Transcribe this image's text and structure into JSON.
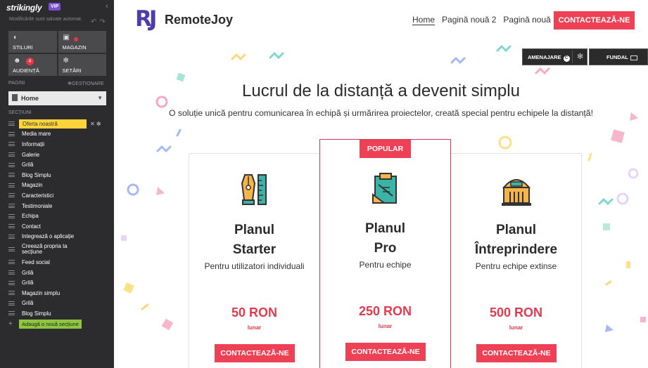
{
  "editor": {
    "logo": "strikingly",
    "vip": "VIP",
    "autosave": "Modificările sunt salvate automat.",
    "tiles": [
      {
        "label": "STILURI",
        "icon": "palette-icon"
      },
      {
        "label": "MAGAZIN",
        "icon": "bag-icon"
      },
      {
        "label": "AUDIENȚĂ",
        "icon": "people-icon",
        "count": "4"
      },
      {
        "label": "SETĂRI",
        "icon": "gear-icon"
      }
    ],
    "pages_label": "PAGINI",
    "manage_label": "GESTIONARE",
    "current_page": "Home",
    "sections_label": "SECȚIUNI",
    "sections": [
      "Oferta noastră",
      "Media mare",
      "Informații",
      "Galerie",
      "Grilă",
      "Blog Simplu",
      "Magazin",
      "Caracteristici",
      "Testimoniale",
      "Echipa",
      "Contact",
      "Integrează o aplicație",
      "Creează propria ta secțiune",
      "Feed social",
      "Grilă",
      "Grilă",
      "Magazin simplu",
      "Grilă",
      "Blog Simplu"
    ],
    "add_section": "Adaugă o nouă secțiune"
  },
  "site": {
    "brand_mark": "RJ",
    "brand_name": "RemoteJoy",
    "nav": [
      "Home",
      "Pagină nouă 2",
      "Pagină nouă 3"
    ],
    "cta": "CONTACTEAZĂ-NE",
    "design_btn": "AMENAJARE",
    "background_btn": "FUNDAL",
    "headline": "Lucrul de la distanță a devenit simplu",
    "subheadline": "O soluție unică pentru comunicarea în echipă și urmărirea proiectelor, creată special pentru echipele la distanță!",
    "plans": [
      {
        "name": "Planul Starter",
        "name1": "Planul",
        "name2": "Starter",
        "desc": "Pentru utilizatori individuali",
        "price": "50 RON",
        "period": "lunar",
        "button": "CONTACTEAZĂ-NE",
        "icon": "pen-ruler-icon"
      },
      {
        "badge": "POPULAR",
        "name1": "Planul",
        "name2": "Pro",
        "desc": "Pentru echipe",
        "price": "250 RON",
        "period": "lunar",
        "button": "CONTACTEAZĂ-NE",
        "icon": "clipboard-icon"
      },
      {
        "name1": "Planul",
        "name2": "Întreprindere",
        "desc": "Pentru echipe extinse",
        "price": "500 RON",
        "period": "lunar",
        "button": "CONTACTEAZĂ-NE",
        "icon": "building-icon"
      }
    ],
    "colors": {
      "accent": "#ee4155",
      "brand": "#4e3da9"
    }
  }
}
